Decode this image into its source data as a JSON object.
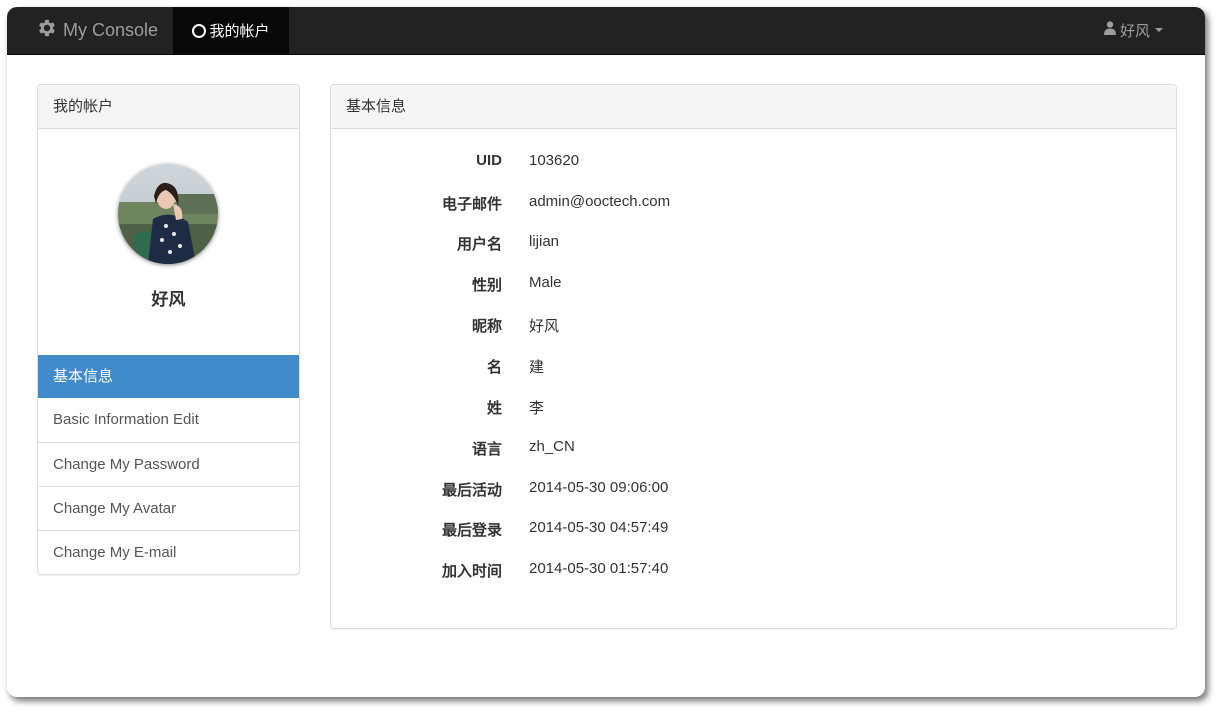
{
  "navbar": {
    "brand": "My Console",
    "active_item": "我的帐户",
    "user": "好风",
    "background": "#222222"
  },
  "sidebar": {
    "heading": "我的帐户",
    "profile_name": "好风",
    "active_color": "#428bca",
    "items": [
      {
        "label": "基本信息",
        "active": true
      },
      {
        "label": "Basic Information Edit",
        "active": false
      },
      {
        "label": "Change My Password",
        "active": false
      },
      {
        "label": "Change My Avatar",
        "active": false
      },
      {
        "label": "Change My E-mail",
        "active": false
      }
    ]
  },
  "main": {
    "heading": "基本信息",
    "rows": [
      {
        "label": "UID",
        "value": "103620"
      },
      {
        "label": "电子邮件",
        "value": "admin@ooctech.com"
      },
      {
        "label": "用户名",
        "value": "lijian"
      },
      {
        "label": "性别",
        "value": "Male"
      },
      {
        "label": "昵称",
        "value": "好风"
      },
      {
        "label": "名",
        "value": "建"
      },
      {
        "label": "姓",
        "value": "李"
      },
      {
        "label": "语言",
        "value": "zh_CN"
      },
      {
        "label": "最后活动",
        "value": "2014-05-30 09:06:00"
      },
      {
        "label": "最后登录",
        "value": "2014-05-30 04:57:49"
      },
      {
        "label": "加入时间",
        "value": "2014-05-30 01:57:40"
      }
    ]
  }
}
